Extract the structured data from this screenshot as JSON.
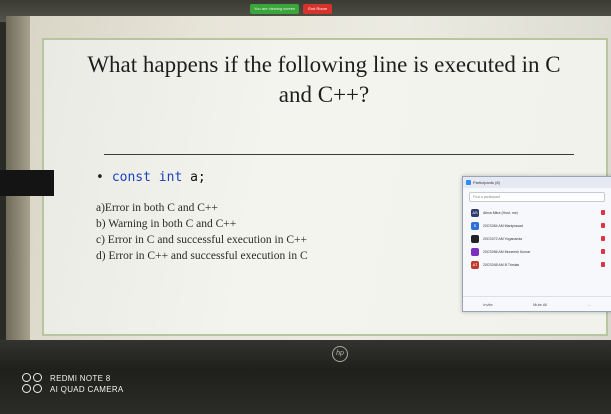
{
  "zoom_bar": {
    "status": "You are viewing screen",
    "end_button": "End Room"
  },
  "slide": {
    "title": "What happens if the following line is executed in C and C++?",
    "code": {
      "bullet": "•",
      "keywords": "const int",
      "identifier": "a;"
    },
    "options": [
      "a)Error in both C and C++",
      "b) Warning in both C and C++",
      "c) Error in C and successful execution in C++",
      "d) Error in C++ and successful execution in C"
    ]
  },
  "participants_panel": {
    "title": "Participants (8)",
    "search_placeholder": "Find a participant",
    "participants": [
      {
        "initial": "AS",
        "name": "Alexa Mitra (Host, me) ",
        "color": "#2f3b6e"
      },
      {
        "initial": "S",
        "name": "20CS054 AM Maniprasad",
        "color": "#2d6fd6"
      },
      {
        "initial": "",
        "name": "20CS072 AM Yogananda",
        "color": "#222222"
      },
      {
        "initial": "",
        "name": "20CS056 AM Muneesh Kumar",
        "color": "#7a2fc0"
      },
      {
        "initial": "AT",
        "name": "20CS048 AM B Trimlas",
        "color": "#c0392b"
      }
    ],
    "footer": [
      "Invite",
      "Mute All",
      "..."
    ]
  },
  "laptop": {
    "brand_logo": "hp"
  },
  "watermark": {
    "line1": "REDMI NOTE 8",
    "line2": "AI QUAD CAMERA"
  }
}
